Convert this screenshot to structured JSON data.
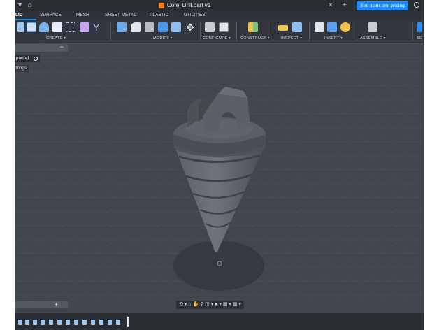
{
  "titlebar": {
    "document_title": "Core_Drill.part v1",
    "cta_label": "See plans and pricing",
    "dropdown_glyph": "▾",
    "home_glyph": "⌂",
    "close_glyph": "×",
    "add_glyph": "+",
    "brand_color": "#f07a1a",
    "cta_color": "#1a8cff"
  },
  "tabs": [
    {
      "label": "LID",
      "active": true
    },
    {
      "label": "SURFACE",
      "active": false
    },
    {
      "label": "MESH",
      "active": false
    },
    {
      "label": "SHEET METAL",
      "active": false
    },
    {
      "label": "PLASTIC",
      "active": false
    },
    {
      "label": "UTILITIES",
      "active": false
    }
  ],
  "ribbon": {
    "groups": [
      "CREATE ▾",
      "MODIFY ▾",
      "CONFIGURE ▾",
      "CONSTRUCT ▾",
      "INSPECT ▾",
      "INSERT ▾",
      "ASSEMBLE ▾",
      "SE"
    ]
  },
  "browser": {
    "collapse_glyph": "−",
    "item_label": "part v1",
    "settings_label": "ttings"
  },
  "comments": {
    "add_glyph": "+"
  },
  "nav_toolbar": {
    "glyphs": "⟲ ▾ ⌂ ✋ ⚲ ◫ ▾ ■ ▾ ▦ ▾ ▦ ▾"
  }
}
